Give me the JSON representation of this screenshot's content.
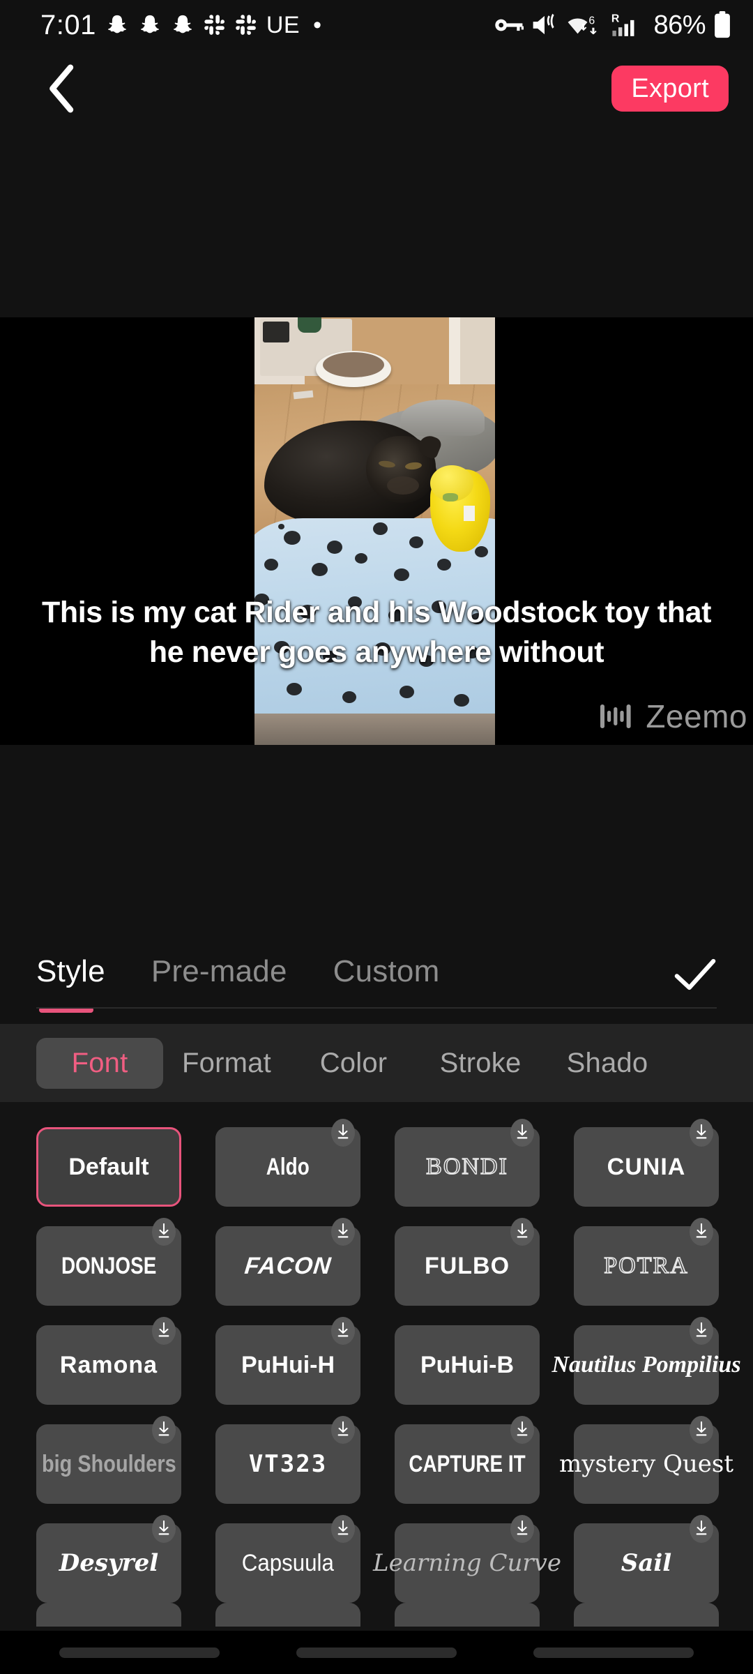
{
  "status_bar": {
    "time": "7:01",
    "left_icons": [
      "snapchat-icon",
      "snapchat-icon",
      "snapchat-icon",
      "slack-icon",
      "slack-icon"
    ],
    "carrier_label": "UE",
    "dot_indicator": "•",
    "right_icons": [
      "vpn-key-icon",
      "mute-vibrate-icon",
      "wifi-6-icon",
      "roaming-signal-icon"
    ],
    "battery_percent": "86%",
    "wifi_generation": "6",
    "roaming_label": "R"
  },
  "top_bar": {
    "back_label": "Back",
    "export_label": "Export",
    "export_color": "#FC3A62"
  },
  "preview": {
    "caption_text": "This is my cat Rider and his Woodstock toy that he never goes anywhere without",
    "watermark_label": "Zeemo",
    "watermark_icon": "audio-waveform-icon",
    "scene_description": "black cat lying on a light blue paw-print blanket beside a yellow Woodstock plush toy"
  },
  "tabs": {
    "items": [
      {
        "label": "Style",
        "active": true
      },
      {
        "label": "Pre-made",
        "active": false
      },
      {
        "label": "Custom",
        "active": false
      }
    ],
    "confirm_icon": "checkmark-icon",
    "active_underline_color": "#E8547C"
  },
  "subtabs": {
    "items": [
      {
        "label": "Font",
        "active": true
      },
      {
        "label": "Format",
        "active": false
      },
      {
        "label": "Color",
        "active": false
      },
      {
        "label": "Stroke",
        "active": false
      },
      {
        "label": "Shado",
        "active": false
      }
    ],
    "active_color": "#F05E82"
  },
  "font_grid": {
    "download_icon": "download-arrow-icon",
    "selected_border_color": "#E8547C",
    "fonts": [
      {
        "label": "Default",
        "style": "f-default",
        "selected": true,
        "downloadable": false
      },
      {
        "label": "Aldo",
        "style": "f-cond",
        "selected": false,
        "downloadable": true
      },
      {
        "label": "BONDI",
        "style": "f-outline",
        "selected": false,
        "downloadable": true
      },
      {
        "label": "CUNIA",
        "style": "f-heavy",
        "selected": false,
        "downloadable": true
      },
      {
        "label": "DONJOSE",
        "style": "f-cond",
        "selected": false,
        "downloadable": true
      },
      {
        "label": "FACON",
        "style": "f-italic",
        "selected": false,
        "downloadable": true
      },
      {
        "label": "FULBO",
        "style": "f-heavy",
        "selected": false,
        "downloadable": true
      },
      {
        "label": "POTRA",
        "style": "f-outline",
        "selected": false,
        "downloadable": true
      },
      {
        "label": "Ramona",
        "style": "f-heavy",
        "selected": false,
        "downloadable": true
      },
      {
        "label": "PuHui-H",
        "style": "f-default",
        "selected": false,
        "downloadable": true
      },
      {
        "label": "PuHui-B",
        "style": "f-default",
        "selected": false,
        "downloadable": false
      },
      {
        "label": "Nautilus Pompilius",
        "style": "f-serif",
        "selected": false,
        "downloadable": true
      },
      {
        "label": "big Shoulders",
        "style": "f-dim",
        "selected": false,
        "downloadable": true
      },
      {
        "label": "VT323",
        "style": "f-mono",
        "selected": false,
        "downloadable": true
      },
      {
        "label": "CAPTURE IT",
        "style": "f-cond",
        "selected": false,
        "downloadable": true
      },
      {
        "label": "mystery Quest",
        "style": "f-quest",
        "selected": false,
        "downloadable": true
      },
      {
        "label": "Desyrel",
        "style": "f-hand",
        "selected": false,
        "downloadable": true
      },
      {
        "label": "Capsuula",
        "style": "f-thin",
        "selected": false,
        "downloadable": true
      },
      {
        "label": "Learning Curve",
        "style": "f-script-dim",
        "selected": false,
        "downloadable": true
      },
      {
        "label": "Sail",
        "style": "f-fancy",
        "selected": false,
        "downloadable": true
      }
    ]
  },
  "nav_bar": {
    "buttons": [
      "recents-button",
      "home-button",
      "back-button"
    ]
  }
}
